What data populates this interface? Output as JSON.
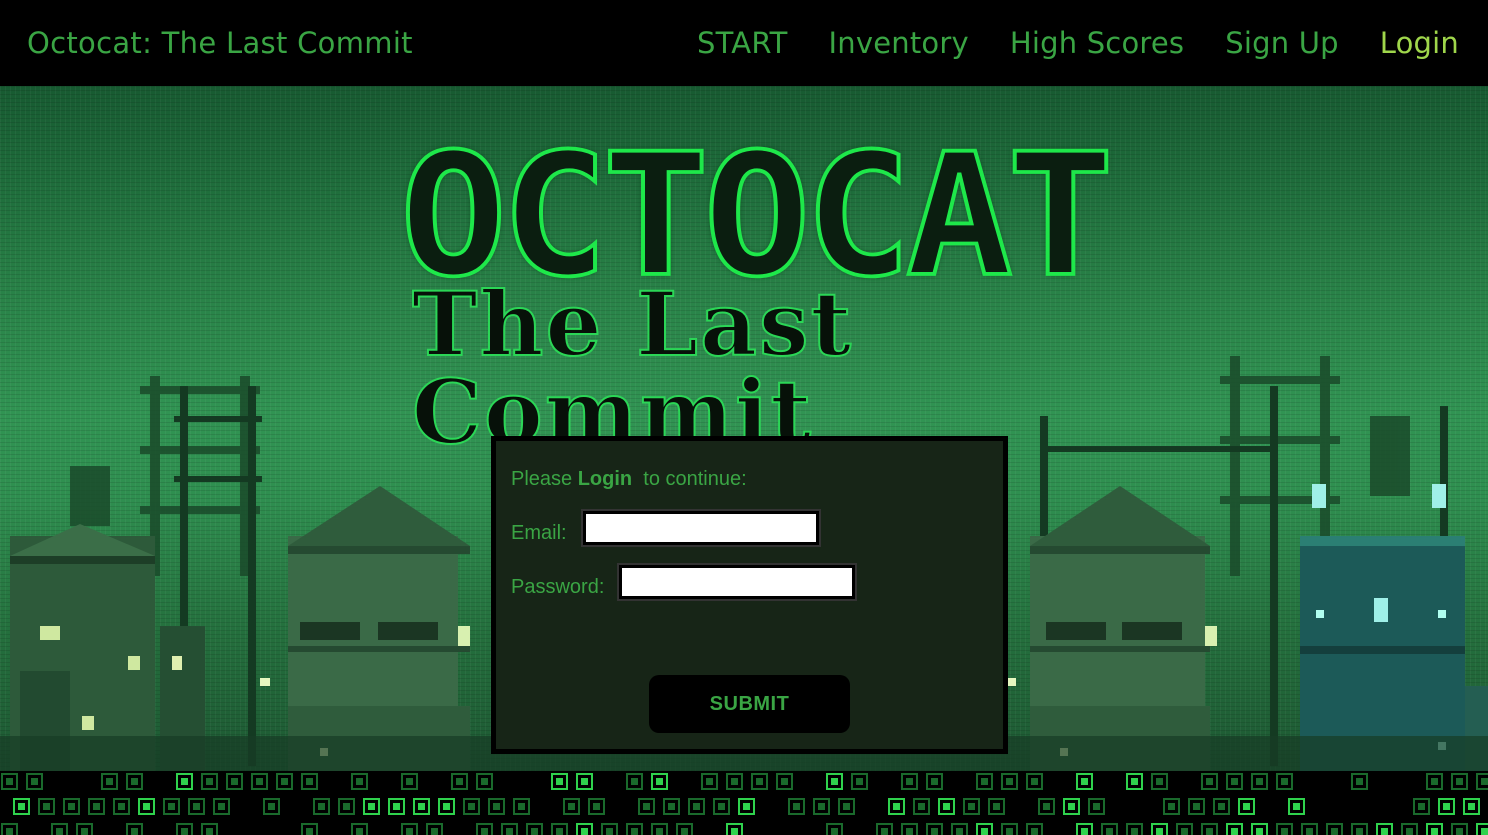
{
  "nav": {
    "brand": "Octocat: The Last Commit",
    "links": [
      {
        "label": "START",
        "active": false
      },
      {
        "label": "Inventory",
        "active": false
      },
      {
        "label": "High Scores",
        "active": false
      },
      {
        "label": "Sign Up",
        "active": false
      },
      {
        "label": "Login",
        "active": true
      }
    ]
  },
  "hero": {
    "title": "OCTOCAT",
    "subtitle": "The Last Commit"
  },
  "login": {
    "prompt_prefix": "Please ",
    "prompt_bold": "Login",
    "prompt_suffix": "  to continue:",
    "email_label": "Email:",
    "email_value": "",
    "password_label": "Password:",
    "password_value": "",
    "submit_label": "SUBMIT"
  },
  "colors": {
    "nav_text": "#3aa544",
    "nav_active": "#9fd64b",
    "panel_bg": "#172517",
    "logo_outline": "#1ee84a",
    "footer_block_bright": "#2fd24d",
    "footer_block_dim": "#1a6a2c"
  }
}
